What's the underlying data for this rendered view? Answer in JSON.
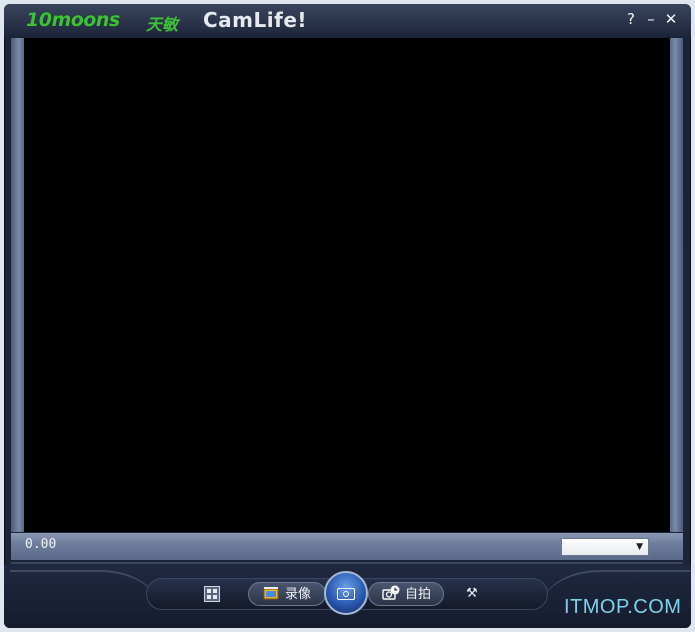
{
  "titlebar": {
    "brand": "10moons",
    "brand_cn": "天敏",
    "app_title": "CamLife!",
    "help_label": "?",
    "minimize_label": "–",
    "close_label": "✕"
  },
  "status_bar": {
    "readout": "0.00",
    "select_value": ""
  },
  "controls": {
    "record_label": "录像",
    "selftimer_label": "自拍"
  },
  "watermark": "ITMOP.COM",
  "colors": {
    "brand_green": "#3fbf3a",
    "frame_dark": "#1c2438",
    "capture_button_blue": "#2a58b0",
    "watermark": "#7fd2ea"
  },
  "icons": [
    "film-grid-icon",
    "record-icon",
    "camera-icon",
    "self-timer-icon",
    "tool-icon",
    "chevron-down-icon"
  ]
}
